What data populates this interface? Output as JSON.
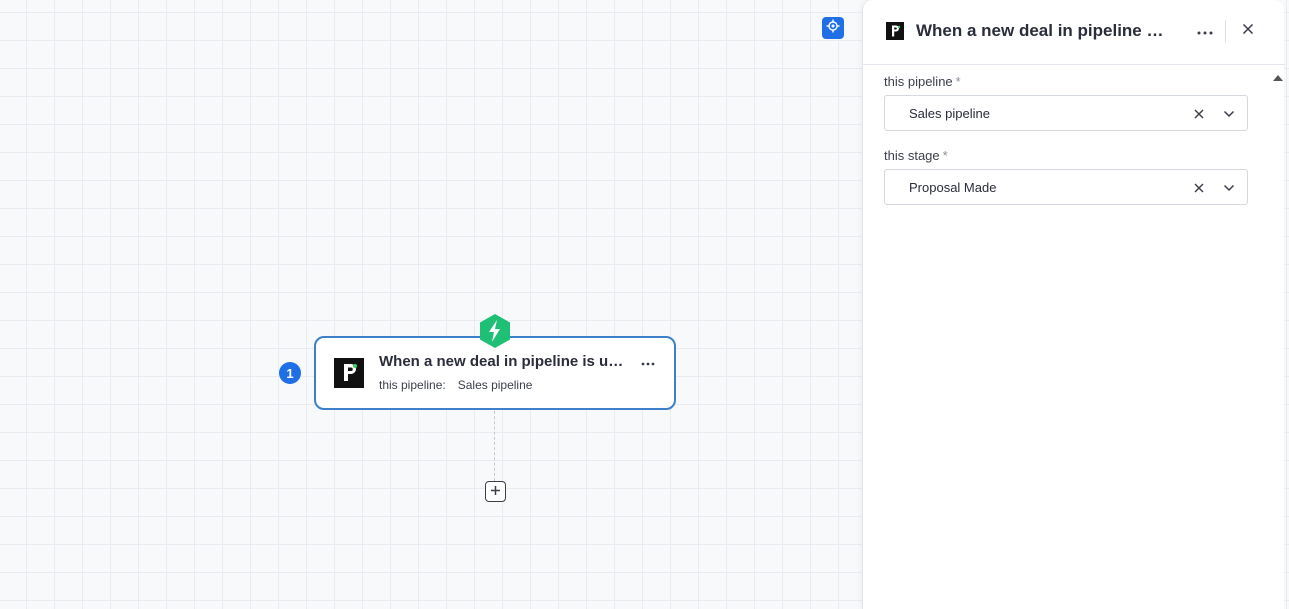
{
  "canvas": {
    "step_number": "1",
    "node": {
      "title": "When a new deal in pipeline is updated",
      "param_label": "this pipeline:",
      "param_value": "Sales pipeline",
      "logo_text": "Pipedrive"
    },
    "icons": {
      "recenter": "crosshair-icon",
      "trigger": "lightning-icon",
      "menu": "more-horizontal-icon",
      "add": "plus-square-icon"
    },
    "accent_color": "#1f6fe6",
    "trigger_color": "#1fbf75"
  },
  "panel": {
    "title": "When a new deal in pipeline is updated",
    "fields": [
      {
        "label": "this pipeline",
        "required_mark": "*",
        "value": "Sales pipeline"
      },
      {
        "label": "this stage",
        "required_mark": "*",
        "value": "Proposal Made"
      }
    ],
    "icons": {
      "menu": "more-horizontal-icon",
      "close": "close-icon",
      "clear": "clear-x-icon",
      "dropdown": "chevron-down-icon"
    }
  }
}
